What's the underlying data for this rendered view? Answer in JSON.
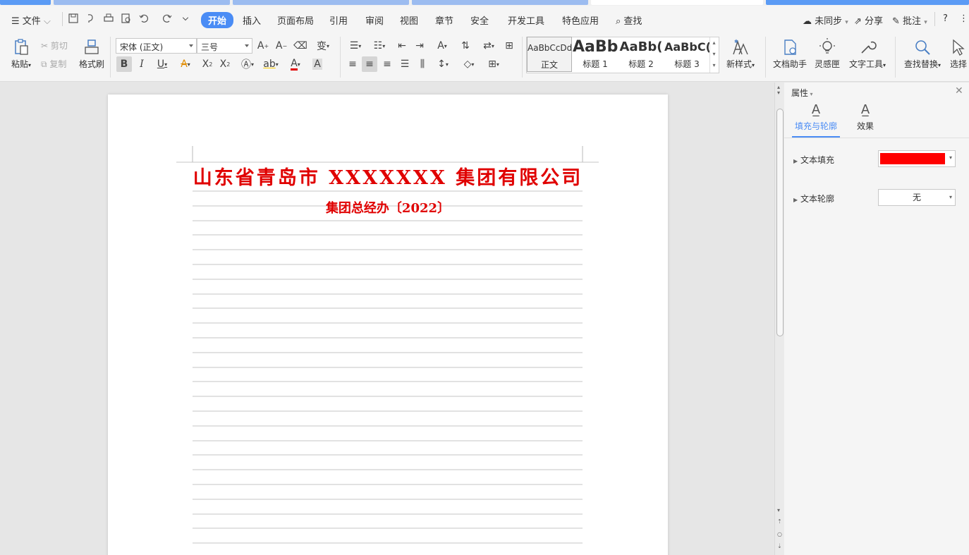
{
  "menu": {
    "file": "文件",
    "tabs": [
      "开始",
      "插入",
      "页面布局",
      "引用",
      "审阅",
      "视图",
      "章节",
      "安全",
      "开发工具",
      "特色应用"
    ],
    "active_tab": "开始",
    "search": "查找",
    "sync": "未同步",
    "share": "分享",
    "comment": "批注",
    "help": "?"
  },
  "ribbon": {
    "paste": "粘贴",
    "cut": "剪切",
    "copy": "复制",
    "format_painter": "格式刷",
    "font_name": "宋体 (正文)",
    "font_size": "三号",
    "styles": [
      {
        "preview": "AaBbCcDd",
        "label": "正文"
      },
      {
        "preview": "AaBb",
        "label": "标题 1"
      },
      {
        "preview": "AaBb(",
        "label": "标题 2"
      },
      {
        "preview": "AaBbC(",
        "label": "标题 3"
      }
    ],
    "new_style": "新样式",
    "doc_assistant": "文档助手",
    "inspiration": "灵感匣",
    "text_tools": "文字工具",
    "find_replace": "查找替换",
    "select": "选择"
  },
  "document": {
    "title": "山东省青岛市 XXXXXXX 集团有限公司",
    "subtitle": "集团总经办〔2022〕"
  },
  "pane": {
    "title": "属性",
    "tab_fill": "填充与轮廓",
    "tab_effect": "效果",
    "text_fill_label": "文本填充",
    "text_outline_label": "文本轮廓",
    "text_outline_value": "无"
  },
  "colors": {
    "accent": "#4a8cf5",
    "title_red": "#e00000",
    "fill_red": "#ff0000"
  }
}
